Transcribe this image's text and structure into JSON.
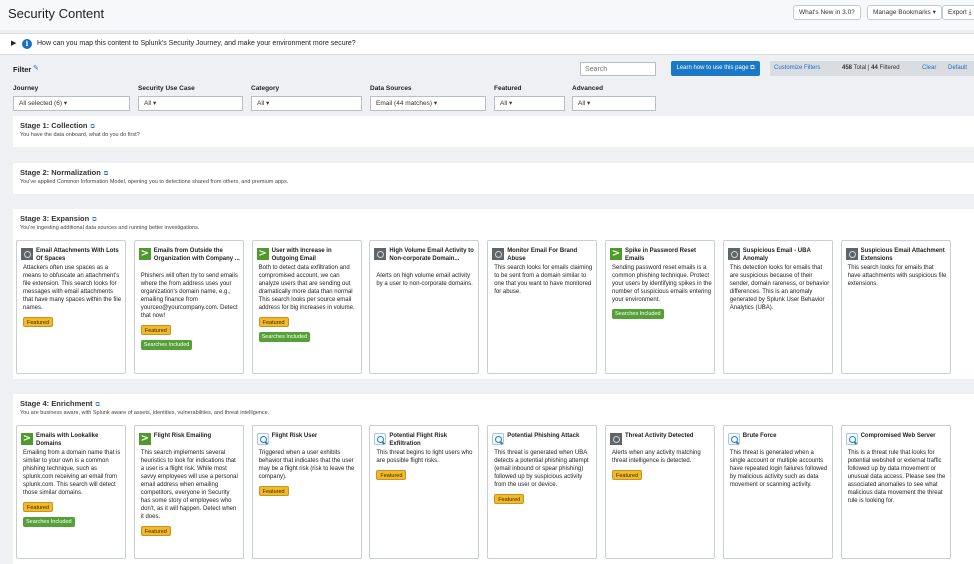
{
  "header": {
    "title": "Security Content",
    "buttons": [
      "What's New in 3.0?",
      "Manage Bookmarks",
      "Export"
    ]
  },
  "journey_banner": {
    "text": "How can you map this content to Splunk's Security Journey, and make your environment more secure?"
  },
  "filter": {
    "label": "Filter",
    "search_placeholder": "Search",
    "learn_button": "Learn how to use this page",
    "customize_link": "Customize Filters",
    "total": "458",
    "total_label": "Total",
    "filtered": "44",
    "filtered_label": "Filtered",
    "clear_link": "Clear",
    "default_link": "Default",
    "fields": [
      {
        "label": "Journey",
        "value": "All selected (6)"
      },
      {
        "label": "Security Use Case",
        "value": "All"
      },
      {
        "label": "Category",
        "value": "All"
      },
      {
        "label": "Data Sources",
        "value": "Email (44 matches)"
      },
      {
        "label": "Featured",
        "value": "All"
      },
      {
        "label": "Advanced",
        "value": "All"
      }
    ]
  },
  "badges": {
    "featured": "Featured",
    "searches": "Searches Included"
  },
  "stages": [
    {
      "title": "Stage 1: Collection",
      "desc": "You have the data onboard, what do you do first?"
    },
    {
      "title": "Stage 2: Normalization",
      "desc": "You've applied Common Information Model, opening you to detections shared from others, and premium apps."
    },
    {
      "title": "Stage 3: Expansion",
      "desc": "You're ingesting additional data sources and running better investigations."
    },
    {
      "title": "Stage 4: Enrichment",
      "desc": "You are business aware, with Splunk aware of assets, identities, vulnerabilities, and threat intelligence."
    }
  ],
  "stage3_cards": [
    {
      "icon": "gray",
      "title": "Email Attachments With Lots Of Spaces",
      "desc": "Attackers often use spaces as a means to obfuscate an attachment's file extension. This search looks for messages with email attachments that have many spaces within the file names.",
      "featured": true,
      "searches": false
    },
    {
      "icon": "green",
      "title": "Emails from Outside the Organization with Company ...",
      "desc": "Phishers will often try to send emails where the from address uses your organization's domain name, e.g., emailing finance from yourceo@yourcompany.com. Detect that now!",
      "featured": true,
      "searches": true
    },
    {
      "icon": "green",
      "title": "User with Increase in Outgoing Email",
      "desc": "Both to detect data exfiltration and compromised account, we can analyze users that are sending out dramatically more data than normal This search looks per source email address for big increases in volume.",
      "featured": true,
      "searches": true
    },
    {
      "icon": "gray",
      "title": "High Volume Email Activity to Non-corporate Domain...",
      "desc": "Alerts on high volume email activity by a user to non-corporate domains.",
      "featured": false,
      "searches": false
    },
    {
      "icon": "gray",
      "title": "Monitor Email For Brand Abuse",
      "desc": "This search looks for emails claiming to be sent from a domain similar to one that you want to have monitored for abuse.",
      "featured": false,
      "searches": false
    },
    {
      "icon": "green",
      "title": "Spike in Password Reset Emails",
      "desc": "Sending password reset emails is a common phishing technique. Protect your users by identifying spikes in the number of suspicious emails entering your environment.",
      "featured": false,
      "searches": true
    },
    {
      "icon": "gray",
      "title": "Suspicious Email - UBA Anomaly",
      "desc": "This detection looks for emails that are suspicious because of their sender, domain rareness, or behavior differences. This is an anomaly generated by Splunk User Behavior Analytics (UBA).",
      "featured": false,
      "searches": false
    },
    {
      "icon": "gray",
      "title": "Suspicious Email Attachment Extensions",
      "desc": "This search looks for emails that have attachments with suspicious file extensions.",
      "featured": false,
      "searches": false
    }
  ],
  "stage4_cards": [
    {
      "icon": "green",
      "title": "Emails with Lookalike Domains",
      "desc": "Emailing from a domain name that is similar to your own is a common phishing technique, such as splunk.com receiving an email from splunk.com. This search will detect those similar domains.",
      "featured": true,
      "searches": true
    },
    {
      "icon": "green",
      "title": "Flight Risk Emailing",
      "desc": "This search implements several heuristics to look for indications that a user is a flight risk. While most savvy employees will use a personal email address when emailing competitors, everyone in Security has some story of employees who don't, as it will happen. Detect when it does.",
      "featured": true,
      "searches": false
    },
    {
      "icon": "search",
      "title": "Flight Risk User",
      "desc": "Triggered when a user exhibits behavior that indicates that the user may be a flight risk (risk to leave the company).",
      "featured": true,
      "searches": false
    },
    {
      "icon": "search",
      "title": "Potential Flight Risk Exfiltration",
      "desc": "This threat begins to light users who are possible flight risks.",
      "featured": true,
      "searches": false
    },
    {
      "icon": "search",
      "title": "Potential Phishing Attack",
      "desc": "This threat is generated when UBA detects a potential phishing attempt (email inbound or spear phishing) followed up by suspicious activity from the user or device.",
      "featured": true,
      "searches": false
    },
    {
      "icon": "gray",
      "title": "Threat Activity Detected",
      "desc": "Alerts when any activity matching threat intelligence is detected.",
      "featured": true,
      "searches": false
    },
    {
      "icon": "search",
      "title": "Brute Force",
      "desc": "This threat is generated when a single account or multiple accounts have repeated login failures followed by malicious activity such as data movement or scanning activity.",
      "featured": false,
      "searches": false
    },
    {
      "icon": "search",
      "title": "Compromised Web Server",
      "desc": "This is a threat rule that looks for potential webshell or external traffic followed up by data movement or unusual data access. Please see the associated anomalies to see what malicious data movement the threat rule is looking for.",
      "featured": false,
      "searches": false
    }
  ]
}
